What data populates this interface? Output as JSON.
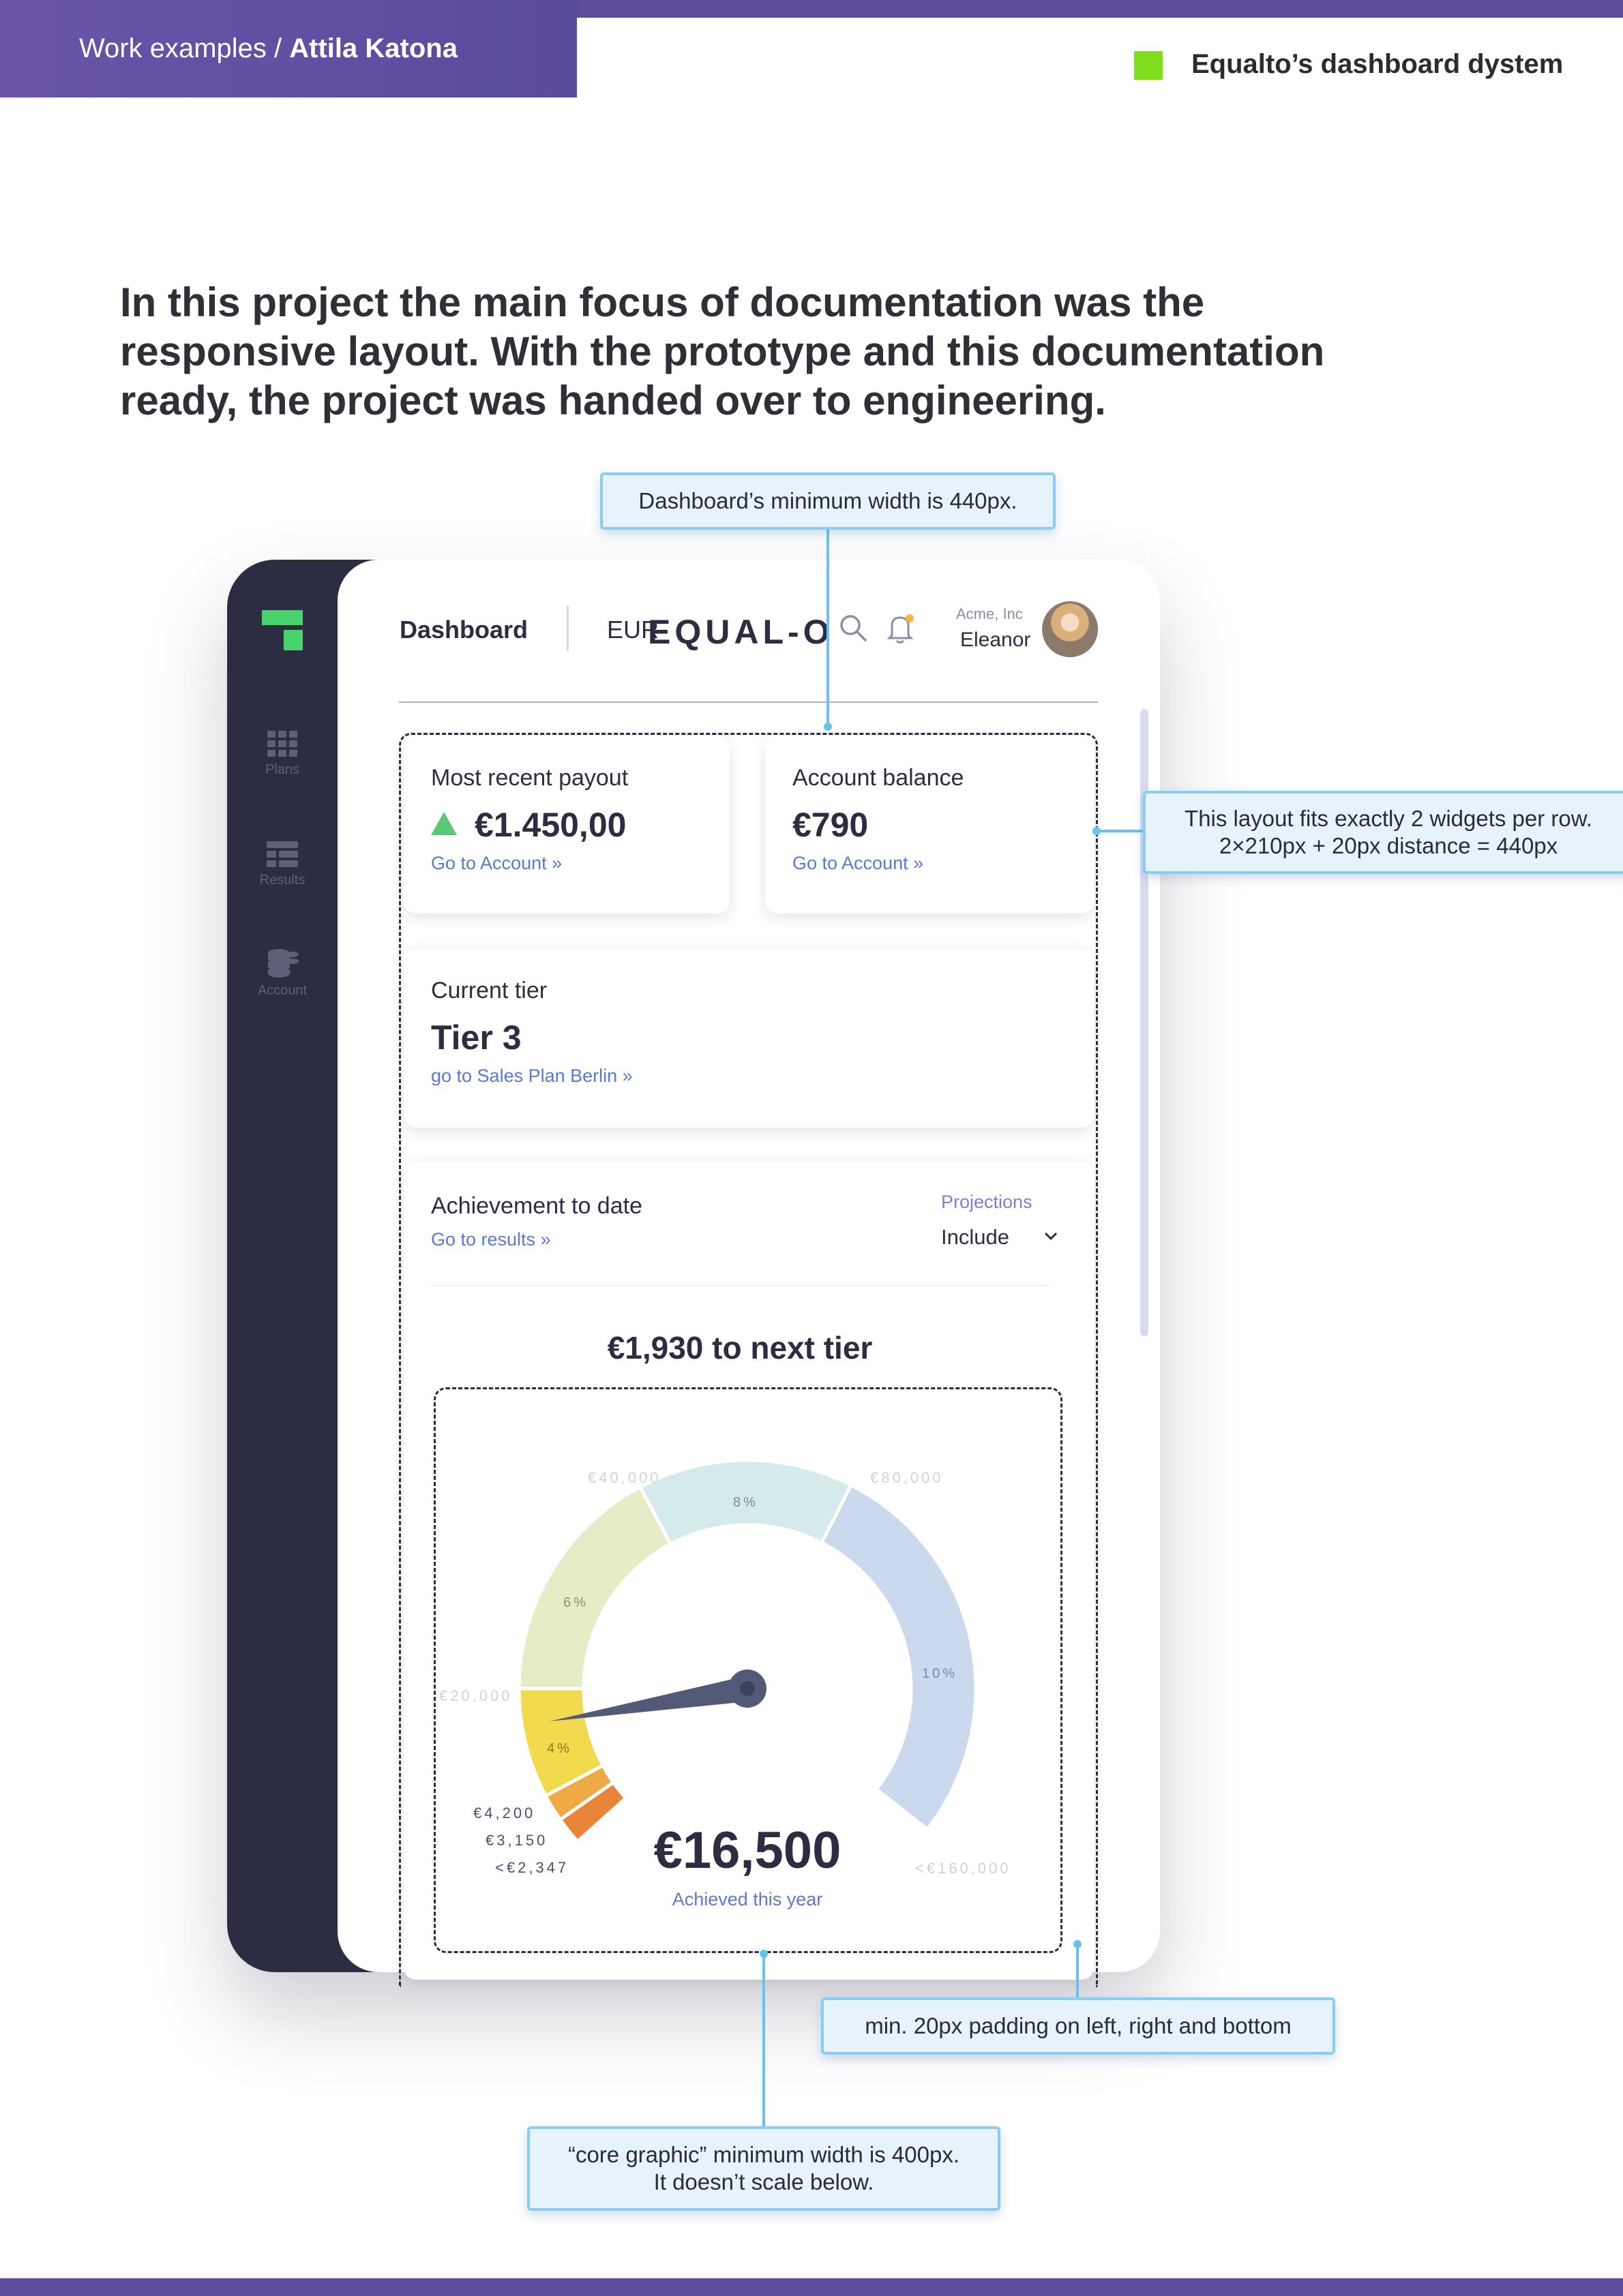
{
  "header": {
    "crumb_prefix": "Work examples /",
    "crumb_author": "Attila Katona",
    "doc_title": "Equalto’s dashboard dystem"
  },
  "intro": "In this project the main focus of documentation was the responsive layout. With the prototype and this documentation ready, the project was handed over to engineering.",
  "sidebar": {
    "items": [
      {
        "label": "Plans",
        "icon": "grid-icon"
      },
      {
        "label": "Results",
        "icon": "table-icon"
      },
      {
        "label": "Account",
        "icon": "coins-icon"
      }
    ]
  },
  "app_header": {
    "title": "Dashboard",
    "currency": "EUR",
    "brand": "EQUAL-O",
    "company": "Acme, Inc",
    "user": "Eleanor"
  },
  "widgets": {
    "payout": {
      "title": "Most recent payout",
      "value": "€1.450,00",
      "link": "Go to Account  »"
    },
    "balance": {
      "title": "Account balance",
      "value": "€790",
      "link": "Go to Account  »"
    },
    "tier": {
      "title": "Current tier",
      "value": "Tier 3",
      "link": "go to Sales Plan Berlin  »"
    },
    "achievement": {
      "title": "Achievement to date",
      "link": "Go to results  »",
      "projections_label": "Projections",
      "projections_value": "Include",
      "next_tier": "€1,930 to next tier"
    }
  },
  "gauge": {
    "value": "€16,500",
    "caption": "Achieved this year",
    "labels": {
      "l20": "€20,000",
      "l40": "€40,000",
      "l80": "€80,000",
      "l160": "<€160,000",
      "l4200": "€4,200",
      "l3150": "€3,150",
      "l2347": "<€2,347"
    },
    "percents": {
      "p4": "4%",
      "p6": "6%",
      "p8": "8%",
      "p10": "10%"
    },
    "colors": {
      "seg_orange": "#e8833a",
      "seg_light_orange": "#eeaa45",
      "seg_yellow": "#f3d94d",
      "seg_lime": "#e6ecc6",
      "seg_teal": "#d4eaeb",
      "seg_blue": "#cbd9ee",
      "needle": "#525a78"
    }
  },
  "callouts": {
    "min_width": "Dashboard’s minimum width is 440px.",
    "two_widgets_1": "This layout fits exactly 2 widgets per row.",
    "two_widgets_2": "2×210px + 20px distance = 440px",
    "padding": "min. 20px padding on left, right and bottom",
    "core_1": "“core graphic” minimum width is 400px.",
    "core_2": "It doesn’t scale below."
  },
  "colors": {
    "brand_purple": "#5d4c9c",
    "brand_green": "#7fdd1e",
    "sidebar_dark": "#2c2d42",
    "link_blue": "#5a78d6",
    "callout_border": "#8acdf2"
  }
}
